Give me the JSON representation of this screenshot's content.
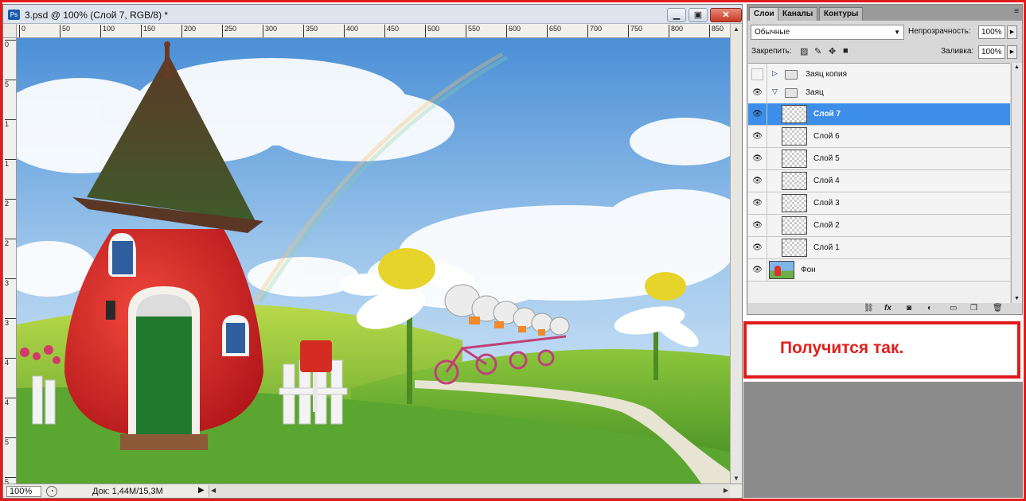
{
  "document": {
    "title": "3.psd @ 100% (Слой 7, RGB/8) *",
    "app_badge": "Ps",
    "window_buttons": {
      "minimize": "▁",
      "maximize": "▣",
      "close": "✕"
    },
    "ruler_top_marks": [
      "0",
      "50",
      "100",
      "150",
      "200",
      "250",
      "300",
      "350",
      "400",
      "450",
      "500",
      "550",
      "600",
      "650",
      "700",
      "750",
      "800",
      "850"
    ],
    "ruler_left_marks": [
      "0",
      "5",
      "1",
      "1",
      "2",
      "2",
      "3",
      "3",
      "4",
      "4",
      "5",
      "5"
    ],
    "status": {
      "zoom": "100%",
      "doc_size": "Док: 1,44M/15,3M"
    }
  },
  "layers_panel": {
    "tabs": [
      "Слои",
      "Каналы",
      "Контуры"
    ],
    "active_tab": "Слои",
    "blend_mode": "Обычные",
    "opacity_label": "Непрозрачность:",
    "opacity_value": "100%",
    "lock_label": "Закрепить:",
    "fill_label": "Заливка:",
    "fill_value": "100%",
    "layers": [
      {
        "name": "Заяц копия",
        "type": "group",
        "expanded": false,
        "visible": false
      },
      {
        "name": "Заяц",
        "type": "group",
        "expanded": true,
        "visible": true
      },
      {
        "name": "Слой 7",
        "type": "layer",
        "selected": true,
        "visible": true
      },
      {
        "name": "Слой 6",
        "type": "layer",
        "visible": true
      },
      {
        "name": "Слой 5",
        "type": "layer",
        "visible": true
      },
      {
        "name": "Слой 4",
        "type": "layer",
        "visible": true
      },
      {
        "name": "Слой 3",
        "type": "layer",
        "visible": true
      },
      {
        "name": "Слой 2",
        "type": "layer",
        "visible": true
      },
      {
        "name": "Слой 1",
        "type": "layer",
        "visible": true
      },
      {
        "name": "Фон",
        "type": "background",
        "visible": true
      }
    ],
    "footer_icons": [
      "link-icon",
      "fx-icon",
      "mask-icon",
      "adjustment-icon",
      "new-group-icon",
      "new-layer-icon",
      "trash-icon"
    ]
  },
  "caption": "Получится так.",
  "colors": {
    "frame_red": "#e01b1b",
    "selection_blue": "#3d8ee8",
    "caption_red": "#e0201a"
  }
}
